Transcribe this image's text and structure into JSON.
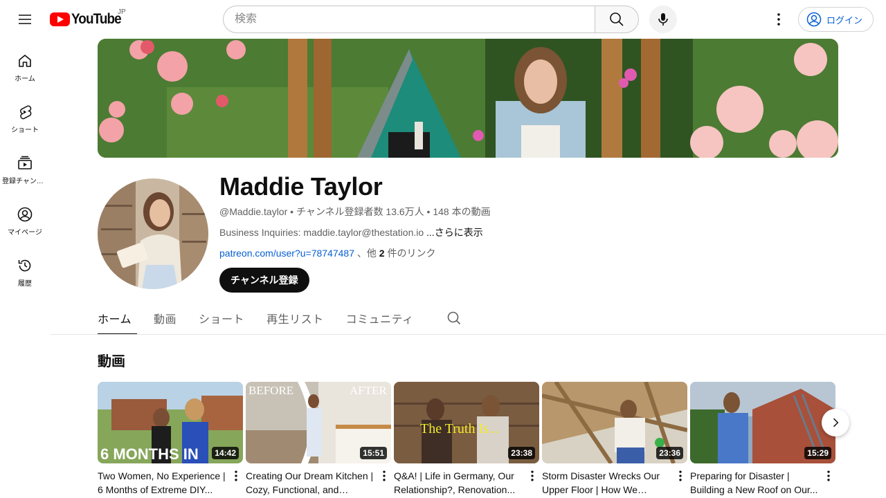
{
  "header": {
    "logo_text": "YouTube",
    "region": "JP",
    "search_placeholder": "検索",
    "login_label": "ログイン"
  },
  "sidebar": {
    "items": [
      {
        "label": "ホーム",
        "icon": "home-icon"
      },
      {
        "label": "ショート",
        "icon": "shorts-icon"
      },
      {
        "label": "登録チャンネル",
        "icon": "subscriptions-icon"
      },
      {
        "label": "マイページ",
        "icon": "you-icon"
      },
      {
        "label": "履歴",
        "icon": "history-icon"
      }
    ]
  },
  "channel": {
    "name": "Maddie Taylor",
    "handle": "@Maddie.taylor",
    "subscribers": "チャンネル登録者数 13.6万人",
    "video_count": "148 本の動画",
    "separator": " • ",
    "description": "Business Inquiries: maddie.taylor@thestation.io ",
    "more_label": "...さらに表示",
    "link_text": "patreon.com/user?u=78747487",
    "link_suffix_pre": " 、他 ",
    "link_count": "2",
    "link_suffix_post": " 件のリンク",
    "subscribe_label": "チャンネル登録"
  },
  "tabs": [
    {
      "label": "ホーム",
      "active": true
    },
    {
      "label": "動画",
      "active": false
    },
    {
      "label": "ショート",
      "active": false
    },
    {
      "label": "再生リスト",
      "active": false
    },
    {
      "label": "コミュニティ",
      "active": false
    }
  ],
  "shelf": {
    "title": "動画",
    "videos": [
      {
        "title": "Two Women, No Experience | 6 Months of Extreme DIY...",
        "duration": "14:42",
        "overlay": "6 MONTHS IN"
      },
      {
        "title": "Creating Our Dream Kitchen | Cozy, Functional, and Budge...",
        "duration": "15:51",
        "overlay_left": "BEFORE",
        "overlay_right": "AFTER"
      },
      {
        "title": "Q&A! | Life in Germany, Our Relationship?, Renovation...",
        "duration": "23:38",
        "overlay": "The Truth Is..."
      },
      {
        "title": "Storm Disaster Wrecks Our Upper Floor | How We Turne...",
        "duration": "23:36"
      },
      {
        "title": "Preparing for Disaster | Building a New Roof on Our...",
        "duration": "15:29"
      }
    ]
  },
  "colors": {
    "brand_red": "#ff0000",
    "link_blue": "#065fd4",
    "text_primary": "#0f0f0f",
    "text_secondary": "#606060"
  }
}
